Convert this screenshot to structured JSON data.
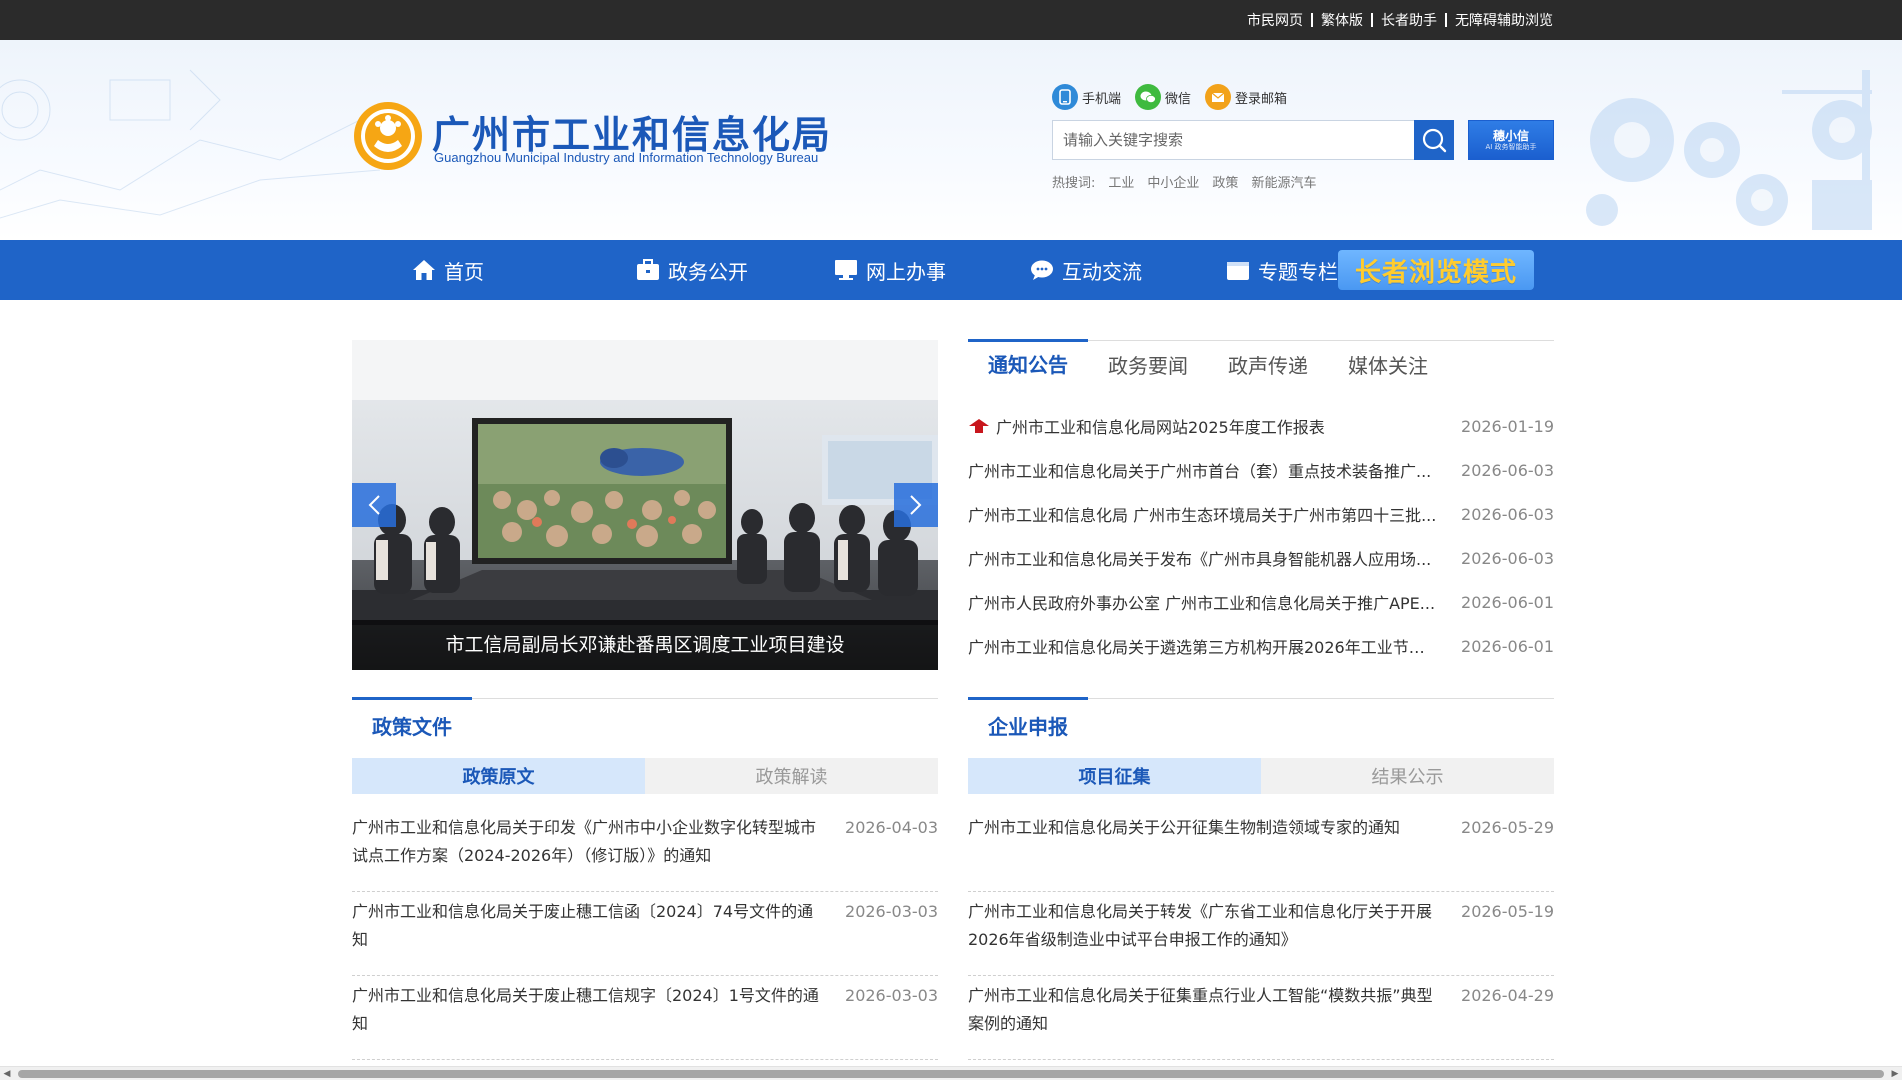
{
  "topbar": {
    "links": [
      "市民网页",
      "繁体版",
      "长者助手",
      "无障碍辅助浏览"
    ]
  },
  "header": {
    "title": "广州市工业和信息化局",
    "subtitle": "Guangzhou Municipal Industry and Information Technology Bureau",
    "quick_links": [
      {
        "label": "手机端",
        "icon": "phone-icon"
      },
      {
        "label": "微信",
        "icon": "wechat-icon"
      },
      {
        "label": "登录邮箱",
        "icon": "mail-icon"
      }
    ],
    "search": {
      "placeholder": "请输入关键字搜索"
    },
    "assistant": {
      "label": "穗小信",
      "sub": "AI 政务智能助手"
    },
    "hotwords_label": "热搜词:",
    "hotwords": [
      "工业",
      "中小企业",
      "政策",
      "新能源汽车"
    ]
  },
  "nav": {
    "items": [
      {
        "label": "首页",
        "icon": "home-icon"
      },
      {
        "label": "政务公开",
        "icon": "briefcase-icon"
      },
      {
        "label": "网上办事",
        "icon": "monitor-icon"
      },
      {
        "label": "互动交流",
        "icon": "chat-icon"
      },
      {
        "label": "专题专栏",
        "icon": "folder-icon"
      }
    ],
    "elder_mode": "长者浏览模式"
  },
  "carousel": {
    "caption": "市工信局副局长邓谦赴番禺区调度工业项目建设"
  },
  "news": {
    "tabs": [
      "通知公告",
      "政务要闻",
      "政声传递",
      "媒体关注"
    ],
    "active_tab": "通知公告",
    "items": [
      {
        "title": "广州市工业和信息化局网站2025年度工作报表",
        "date": "2026-01-19",
        "pinned": true
      },
      {
        "title": "广州市工业和信息化局关于广州市首台（套）重点技术装备推广...",
        "date": "2026-06-03"
      },
      {
        "title": "广州市工业和信息化局 广州市生态环境局关于广州市第四十三批...",
        "date": "2026-06-03"
      },
      {
        "title": "广州市工业和信息化局关于发布《广州市具身智能机器人应用场...",
        "date": "2026-06-03"
      },
      {
        "title": "广州市人民政府外事办公室 广州市工业和信息化局关于推广APE...",
        "date": "2026-06-01"
      },
      {
        "title": "广州市工业和信息化局关于遴选第三方机构开展2026年工业节能...",
        "date": "2026-06-01"
      }
    ]
  },
  "policy": {
    "title": "政策文件",
    "tabs": [
      "政策原文",
      "政策解读"
    ],
    "items": [
      {
        "title": "广州市工业和信息化局关于印发《广州市中小企业数字化转型城市试点工作方案（2024-2026年）（修订版）》的通知",
        "date": "2026-04-03"
      },
      {
        "title": "广州市工业和信息化局关于废止穗工信函〔2024〕74号文件的通知",
        "date": "2026-03-03"
      },
      {
        "title": "广州市工业和信息化局关于废止穗工信规字〔2024〕1号文件的通知",
        "date": "2026-03-03"
      }
    ]
  },
  "enterprise": {
    "title": "企业申报",
    "tabs": [
      "项目征集",
      "结果公示"
    ],
    "items": [
      {
        "title": "广州市工业和信息化局关于公开征集生物制造领域专家的通知",
        "date": "2026-05-29"
      },
      {
        "title": "广州市工业和信息化局关于转发《广东省工业和信息化厅关于开展2026年省级制造业中试平台申报工作的通知》",
        "date": "2026-05-19"
      },
      {
        "title": "广州市工业和信息化局关于征集重点行业人工智能“模数共振”典型案例的通知",
        "date": "2026-04-29"
      }
    ]
  },
  "colors": {
    "brand_blue": "#1f64c8",
    "title_blue": "#1b58b8",
    "topbar": "#2b2b2b",
    "elder_text": "#ffcc2e"
  }
}
